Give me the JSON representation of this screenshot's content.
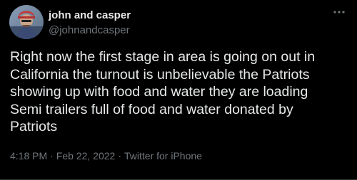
{
  "tweet": {
    "author": {
      "display_name": "john and casper",
      "handle": "@johnandcasper",
      "avatar_icon": "profile-avatar"
    },
    "more_icon": "more-options-icon",
    "text": "Right now the first stage in area is going on out in\nCalifornia the turnout is unbelievable the Patriots\nshowing up with food and water they are loading\nSemi trailers full of food and water donated by\nPatriots",
    "time": "4:18 PM",
    "separator": "·",
    "date": "Feb 22, 2022",
    "source": "Twitter for iPhone"
  },
  "theme": {
    "background": "#000000",
    "text_primary": "#e7e9ea",
    "text_secondary": "#71767b"
  }
}
